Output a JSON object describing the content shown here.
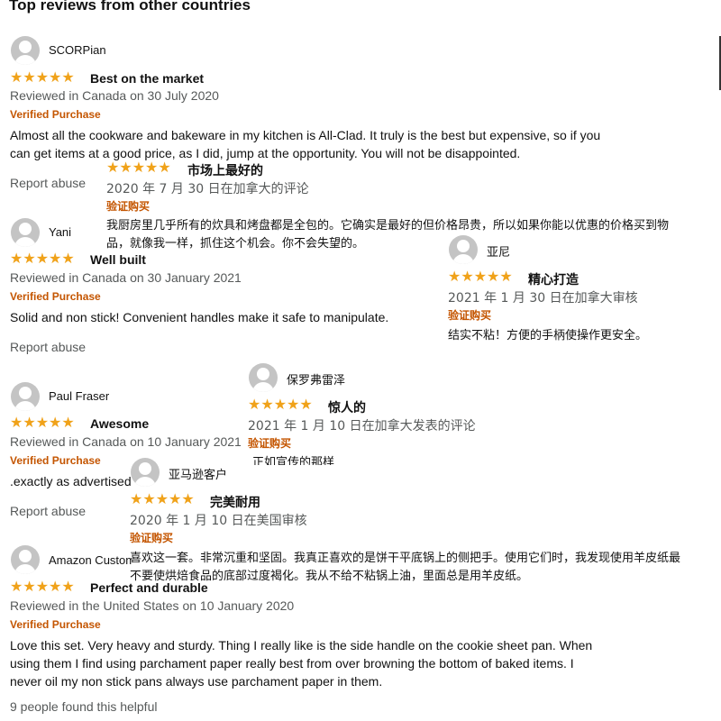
{
  "heading": "Top reviews from other countries",
  "icons": {
    "avatar": "user-silhouette-icon",
    "stars": "five-star-rating-icon"
  },
  "colors": {
    "star": "#f0a21a",
    "verified": "#c45500",
    "meta": "#565959"
  },
  "star_glyphs": "★★★★★",
  "reviews": [
    {
      "name": "SCORPian",
      "title": "Best on the market",
      "meta": "Reviewed in Canada on 30 July 2020",
      "verified": "Verified Purchase",
      "body_line1": "Almost all the cookware and bakeware in my kitchen is All-Clad. It truly is the best but expensive, so if you",
      "body_line2": "can get items at a good price, as I did, jump at the opportunity. You will not be disappointed.",
      "report": "Report abuse"
    },
    {
      "name": "Yani",
      "title": "Well built",
      "meta": "Reviewed in Canada on 30 January 2021",
      "verified": "Verified Purchase",
      "body": "Solid and non stick! Convenient handles make it safe to manipulate.",
      "report": "Report abuse"
    },
    {
      "name": "Paul Fraser",
      "title": "Awesome",
      "meta": "Reviewed in Canada on 10 January 2021",
      "verified": "Verified Purchase",
      "body": ".exactly as advertised",
      "report": "Report abuse"
    },
    {
      "name": "Amazon Customer",
      "title": "Perfect and durable",
      "meta": "Reviewed in the United States on 10 January 2020",
      "verified": "Verified Purchase",
      "body_line1": "Love this set. Very heavy and sturdy. Thing I really like is the side handle on the cookie sheet pan. When",
      "body_line2": "using them I find using parchament paper really best from over browning the bottom of baked items. I",
      "body_line3": "never oil my non stick pans always use parchament paper in them.",
      "helpful": "9 people found this helpful"
    }
  ],
  "translations": [
    {
      "title": "市场上最好的",
      "meta": "2020 年 7 月 30 日在加拿大的评论",
      "verified": "验证购买",
      "body_line1": "我厨房里几乎所有的炊具和烤盘都是全包的。它确实是最好的但价格昂贵，所以如果你能以优惠的价格买到物",
      "body_line2": "品，就像我一样，抓住这个机会。你不会失望的。"
    },
    {
      "name": "亚尼",
      "title": "精心打造",
      "meta": "2021 年 1 月 30 日在加拿大审核",
      "verified": "验证购买",
      "body": "结实不粘！方便的手柄使操作更安全。"
    },
    {
      "name": "保罗弗雷泽",
      "title": "惊人的",
      "meta": "2021 年 1 月 10 日在加拿大发表的评论",
      "verified": "验证购买",
      "body": "正如宣传的那样"
    },
    {
      "name": "亚马逊客户",
      "title": "完美耐用",
      "meta": "2020 年 1 月 10 日在美国审核",
      "verified": "验证购买",
      "body_line1": "喜欢这一套。非常沉重和坚固。我真正喜欢的是饼干平底锅上的侧把手。使用它们时，我发现使用羊皮纸最",
      "body_line2": "不要使烘焙食品的底部过度褐化。我从不给不粘锅上油，里面总是用羊皮纸。"
    }
  ]
}
